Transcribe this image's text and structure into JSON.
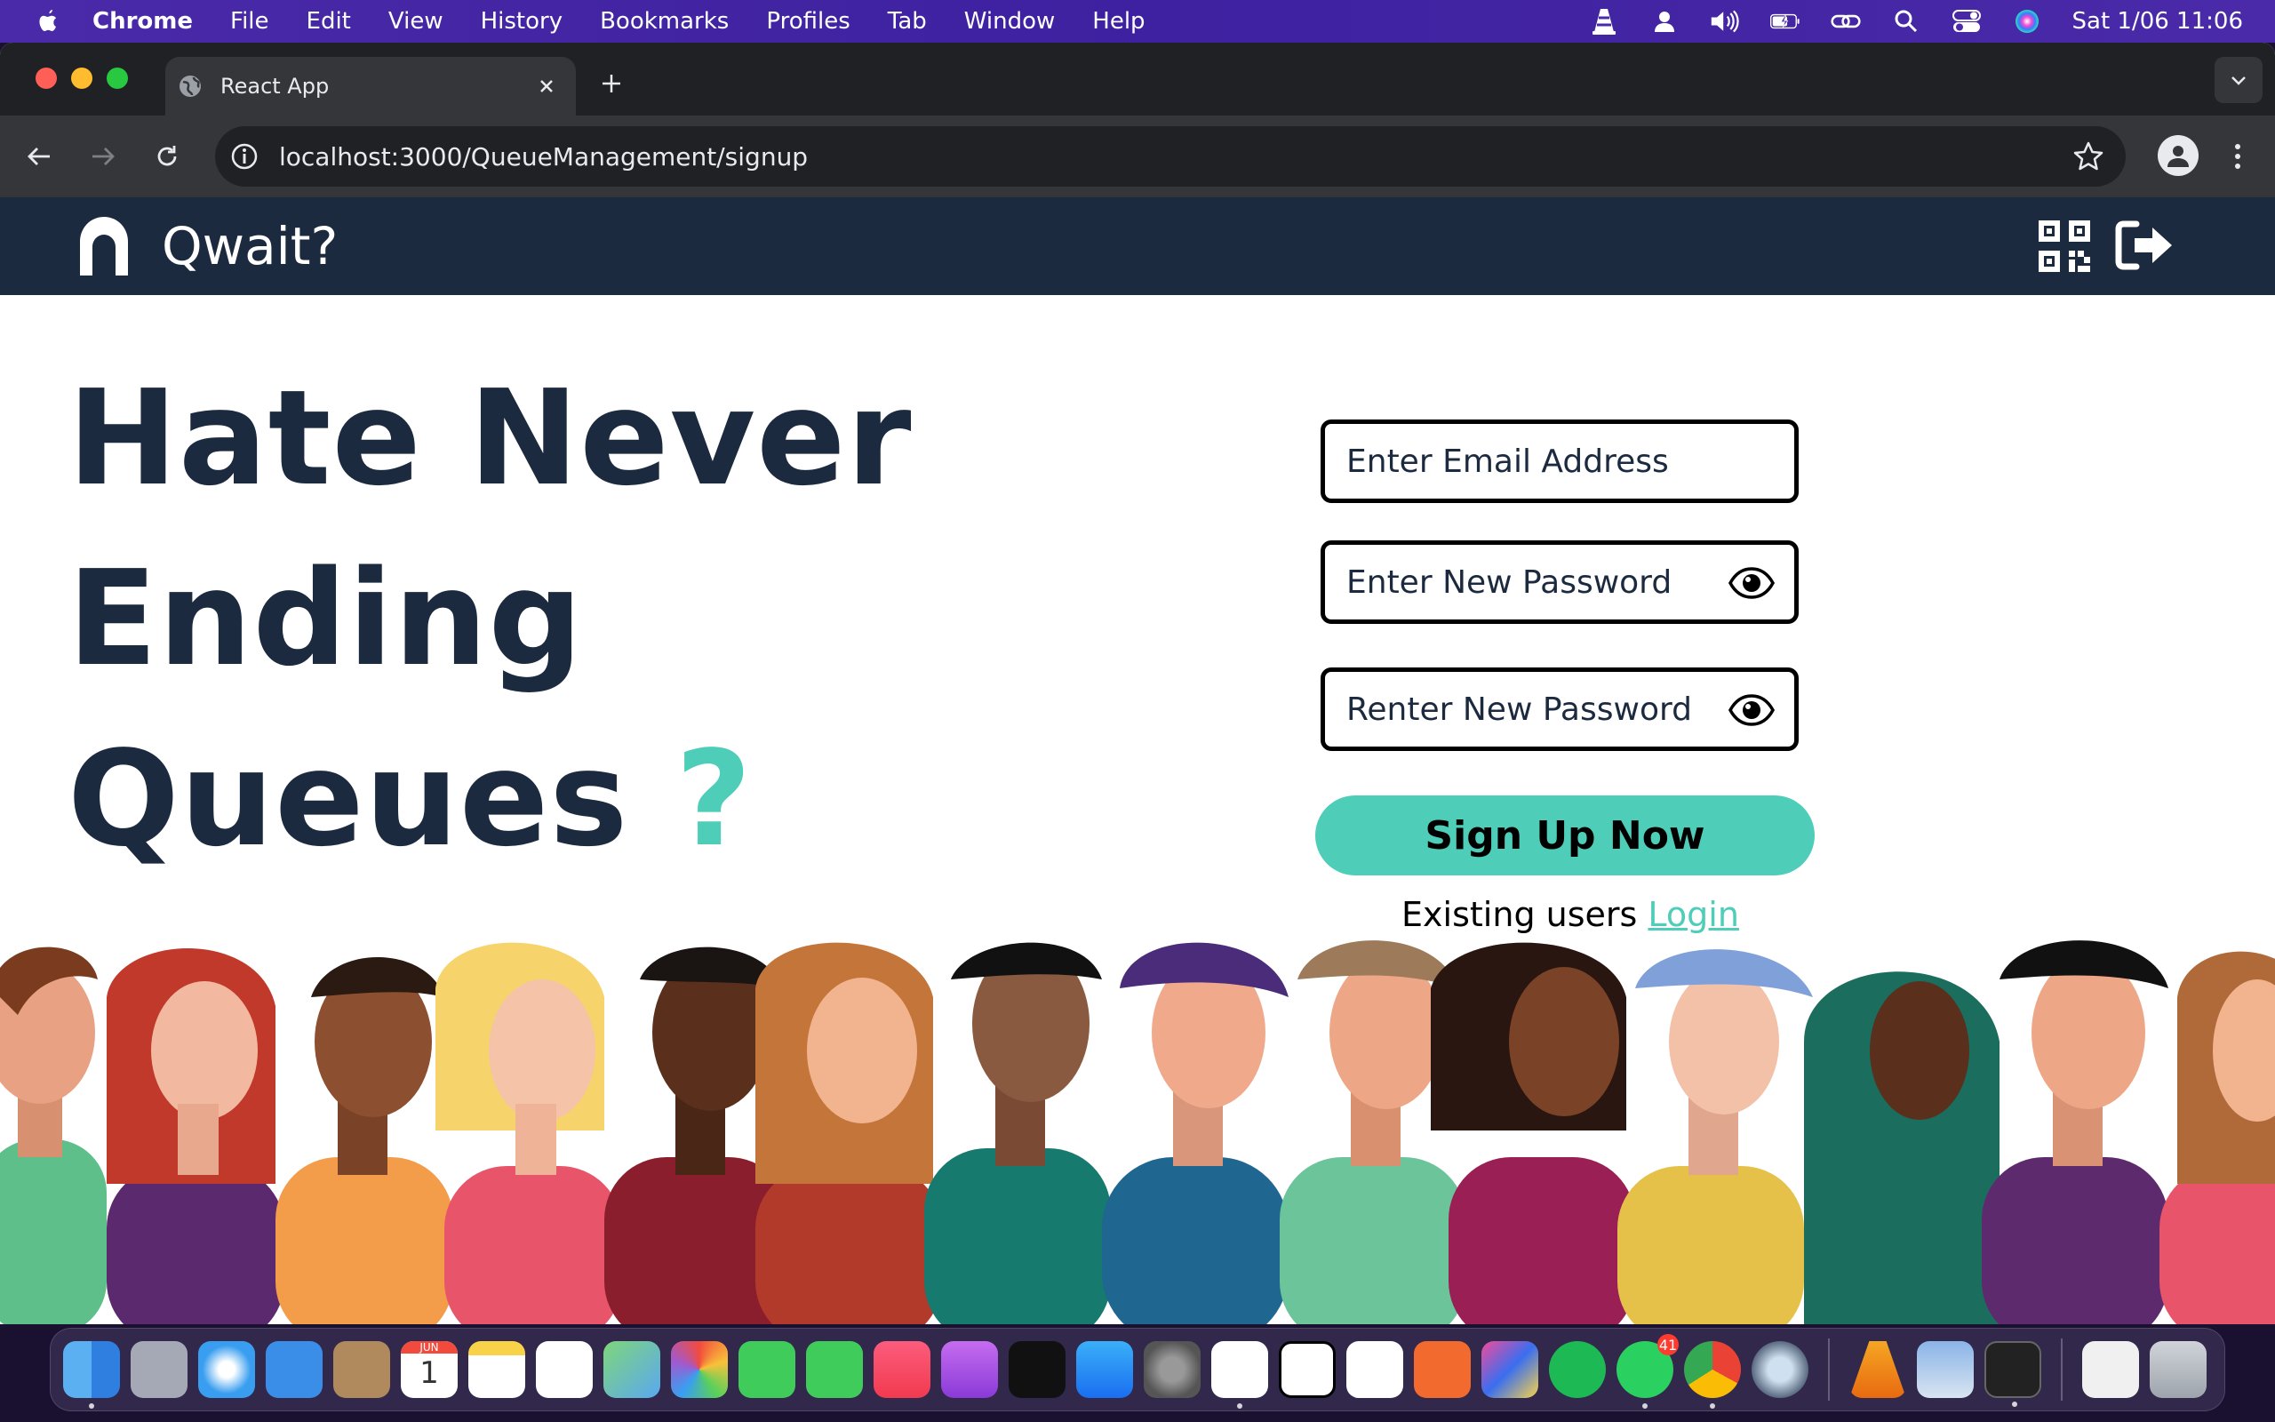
{
  "menubar": {
    "app": "Chrome",
    "items": [
      "File",
      "Edit",
      "View",
      "History",
      "Bookmarks",
      "Profiles",
      "Tab",
      "Window",
      "Help"
    ],
    "clock": "Sat 1/06  11:06",
    "status_icons": [
      "vlc-icon",
      "user-icon",
      "volume-icon",
      "battery-icon",
      "link-icon",
      "search-icon",
      "control-center-icon",
      "siri-icon"
    ]
  },
  "browser": {
    "tab_title": "React App",
    "url": "localhost:3000/QueueManagement/signup"
  },
  "app": {
    "name": "Qwait?",
    "colors": {
      "navbar": "#1c2a3f",
      "accent": "#4ecdb8",
      "heading": "#1c2a3f"
    }
  },
  "hero": {
    "line1": "Hate Never",
    "line2": "Ending",
    "line3": "Queues",
    "mark": "?"
  },
  "form": {
    "email_placeholder": "Enter Email Address",
    "password_placeholder": "Enter New Password",
    "confirm_placeholder": "Renter New Password",
    "submit_label": "Sign Up Now",
    "existing_text": "Existing users",
    "login_link": "Login"
  },
  "dock": {
    "apps": [
      "Finder",
      "Launchpad",
      "Safari",
      "Mail",
      "Contacts",
      "Calendar",
      "Notes",
      "Reminders",
      "Maps",
      "Photos",
      "Messages",
      "FaceTime",
      "Music",
      "Podcasts",
      "TV",
      "App Store",
      "System Settings",
      "VS Code",
      "Notion",
      "Calendar 31",
      "Postman",
      "IntelliJ IDEA",
      "Spotify",
      "WhatsApp",
      "Chrome",
      "QuickTime",
      "VLC",
      "Preview",
      "Terminal",
      "Documents",
      "Trash"
    ],
    "calendar_month": "JUN",
    "calendar_day": "1",
    "whatsapp_badge": "41"
  }
}
